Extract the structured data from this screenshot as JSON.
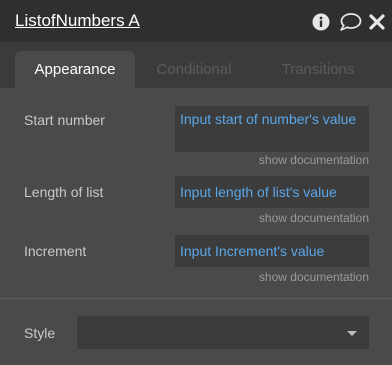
{
  "header": {
    "title": "ListofNumbers A",
    "icons": [
      "info-icon",
      "comment-icon",
      "close-icon"
    ]
  },
  "tabs": [
    {
      "label": "Appearance",
      "active": true
    },
    {
      "label": "Conditional",
      "active": false
    },
    {
      "label": "Transitions",
      "active": false
    }
  ],
  "fields": [
    {
      "label": "Start number",
      "value": "Input start of number's value",
      "doc_link": "show documentation"
    },
    {
      "label": "Length of list",
      "value": "Input length of list's value",
      "doc_link": "show documentation"
    },
    {
      "label": "Increment",
      "value": "Input Increment's value",
      "doc_link": "show documentation"
    }
  ],
  "style": {
    "label": "Style",
    "selected": ""
  },
  "colors": {
    "panel_bg": "#4a4a4a",
    "header_bg": "#2f2f2f",
    "link_blue": "#5aa7e8"
  }
}
